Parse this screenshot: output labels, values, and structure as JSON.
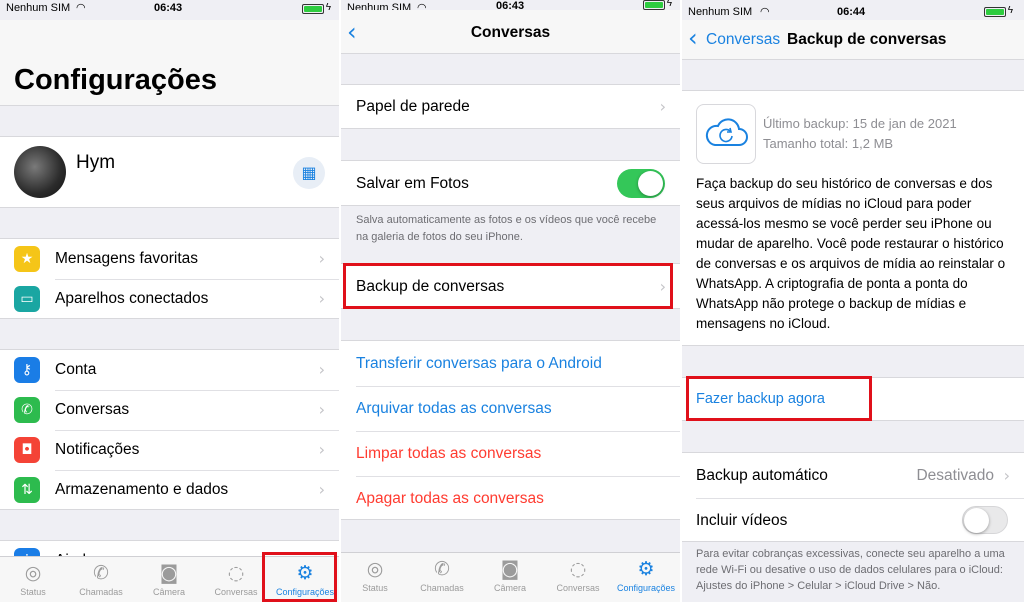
{
  "status": {
    "carrier": "Nenhum SIM",
    "panel1_time": "06:43",
    "panel2_time": "06:43",
    "panel3_time": "06:44"
  },
  "panel1": {
    "title": "Configurações",
    "profile_name": "Hym",
    "group1": [
      {
        "label": "Mensagens favoritas",
        "icon": "star-icon",
        "color": "#f5c518"
      },
      {
        "label": "Aparelhos conectados",
        "icon": "laptop-icon",
        "color": "#1aa6a2"
      }
    ],
    "group2": [
      {
        "label": "Conta",
        "icon": "key-icon",
        "color": "#1a7de6"
      },
      {
        "label": "Conversas",
        "icon": "whatsapp-icon",
        "color": "#2dbb4e"
      },
      {
        "label": "Notificações",
        "icon": "notification-icon",
        "color": "#f44336"
      },
      {
        "label": "Armazenamento e dados",
        "icon": "arrows-icon",
        "color": "#2dbb4e"
      }
    ],
    "group3_partial": "Ajuda"
  },
  "panel2": {
    "title": "Conversas",
    "wallpaper_label": "Papel de parede",
    "save_photos_label": "Salvar em Fotos",
    "save_photos_on": true,
    "save_photos_note": "Salva automaticamente as fotos e os vídeos que você recebe na galeria de fotos do seu iPhone.",
    "backup_label": "Backup de conversas",
    "actions": [
      {
        "label": "Transferir conversas para o Android",
        "style": "link"
      },
      {
        "label": "Arquivar todas as conversas",
        "style": "link"
      },
      {
        "label": "Limpar todas as conversas",
        "style": "danger"
      },
      {
        "label": "Apagar todas as conversas",
        "style": "danger"
      }
    ]
  },
  "panel3": {
    "back_label": "Conversas",
    "title": "Backup de conversas",
    "last_backup": "Último backup: 15 de jan de 2021",
    "total_size": "Tamanho total: 1,2 MB",
    "description": "Faça backup do seu histórico de conversas e dos seus arquivos de mídias no iCloud para poder acessá-los mesmo se você perder seu iPhone ou mudar de aparelho. Você pode restaurar o histórico de conversas e os arquivos de mídia ao reinstalar o WhatsApp. A criptografia de ponta a ponta do WhatsApp não protege o backup de mídias e mensagens no iCloud.",
    "backup_now": "Fazer backup agora",
    "auto_backup_label": "Backup automático",
    "auto_backup_value": "Desativado",
    "include_videos_label": "Incluir vídeos",
    "include_videos_on": false,
    "footnote": "Para evitar cobranças excessivas, conecte seu aparelho a uma rede Wi-Fi ou desative o uso de dados celulares para o iCloud: Ajustes do iPhone > Celular > iCloud Drive > Não."
  },
  "tabs": [
    {
      "label": "Status",
      "icon": "status-icon"
    },
    {
      "label": "Chamadas",
      "icon": "phone-icon"
    },
    {
      "label": "Câmera",
      "icon": "camera-icon"
    },
    {
      "label": "Conversas",
      "icon": "chat-icon"
    },
    {
      "label": "Configurações",
      "icon": "settings-icon"
    }
  ]
}
